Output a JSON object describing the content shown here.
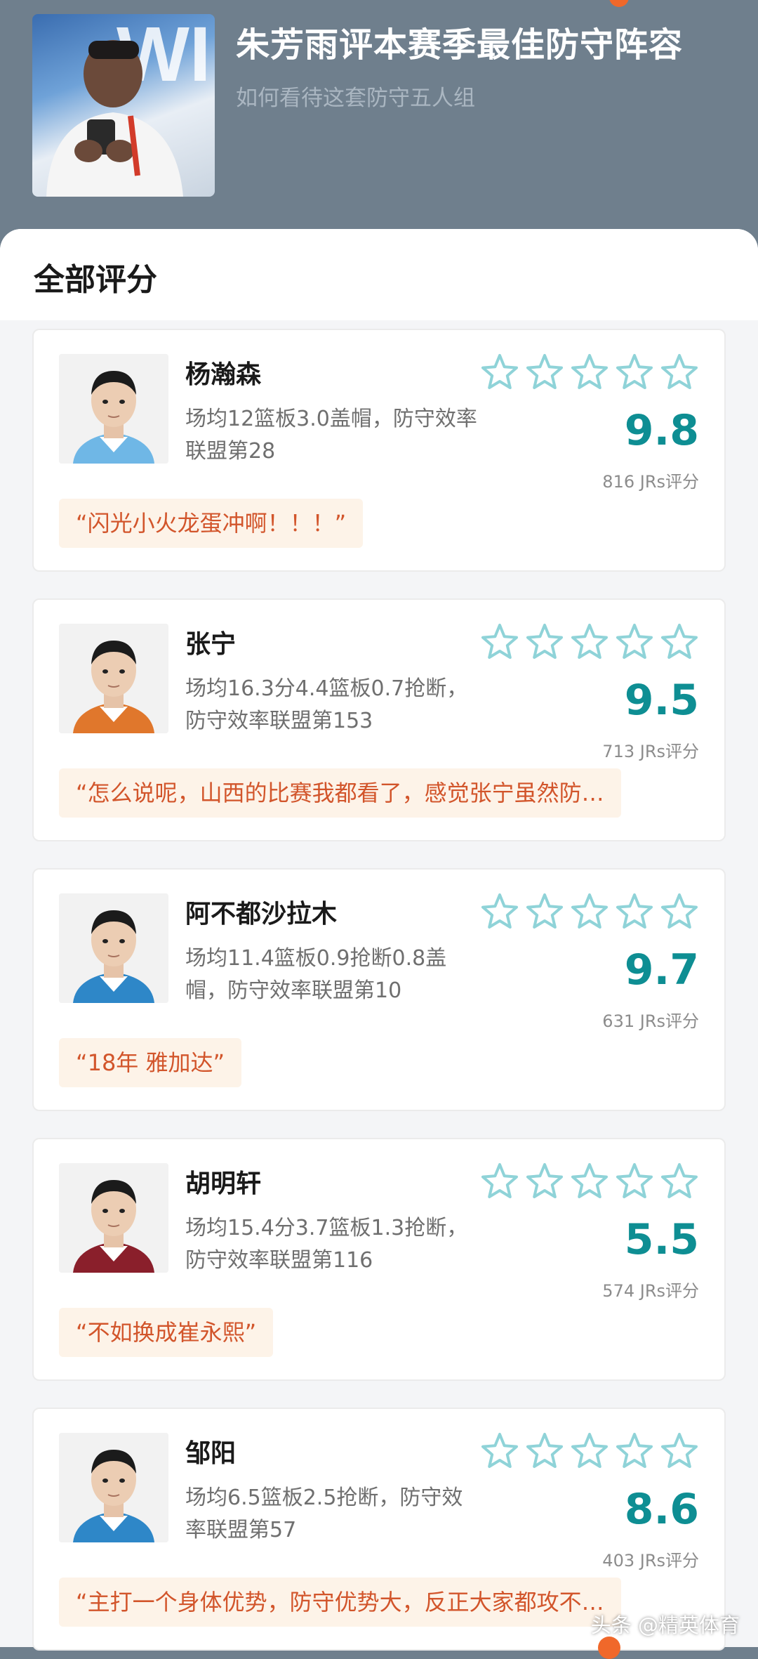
{
  "header": {
    "title": "朱芳雨评本赛季最佳防守阵容",
    "subtitle": "如何看待这套防守五人组"
  },
  "section": {
    "title": "全部评分"
  },
  "colors": {
    "accent": "#0e8e93",
    "star_outline": "#8fd3d8",
    "quote_text": "#d2552b",
    "quote_bg": "#fdf3e8"
  },
  "players": [
    {
      "name": "杨瀚森",
      "desc": "场均12篮板3.0盖帽，防守效率联盟第28",
      "score": "9.8",
      "count": "816 JRs评分",
      "quote": "“闪光小火龙蛋冲啊！！！”",
      "stars_filled": 0,
      "jersey": "#6fb7e6"
    },
    {
      "name": "张宁",
      "desc": "场均16.3分4.4篮板0.7抢断，防守效率联盟第153",
      "score": "9.5",
      "count": "713 JRs评分",
      "quote": "“怎么说呢，山西的比赛我都看了，感觉张宁虽然防…",
      "stars_filled": 0,
      "jersey": "#e0772c"
    },
    {
      "name": "阿不都沙拉木",
      "desc": "场均11.4篮板0.9抢断0.8盖帽，防守效率联盟第10",
      "score": "9.7",
      "count": "631 JRs评分",
      "quote": "“18年 雅加达”",
      "stars_filled": 0,
      "jersey": "#2e87c8"
    },
    {
      "name": "胡明轩",
      "desc": "场均15.4分3.7篮板1.3抢断，防守效率联盟第116",
      "score": "5.5",
      "count": "574 JRs评分",
      "quote": "“不如换成崔永熙”",
      "stars_filled": 0,
      "jersey": "#8a1f2b"
    },
    {
      "name": "邹阳",
      "desc": "场均6.5篮板2.5抢断，防守效率联盟第57",
      "score": "8.6",
      "count": "403 JRs评分",
      "quote": "“主打一个身体优势，防守优势大，反正大家都攻不…",
      "stars_filled": 0,
      "jersey": "#2e87c8"
    }
  ],
  "watermark": "头条 @精英体育"
}
